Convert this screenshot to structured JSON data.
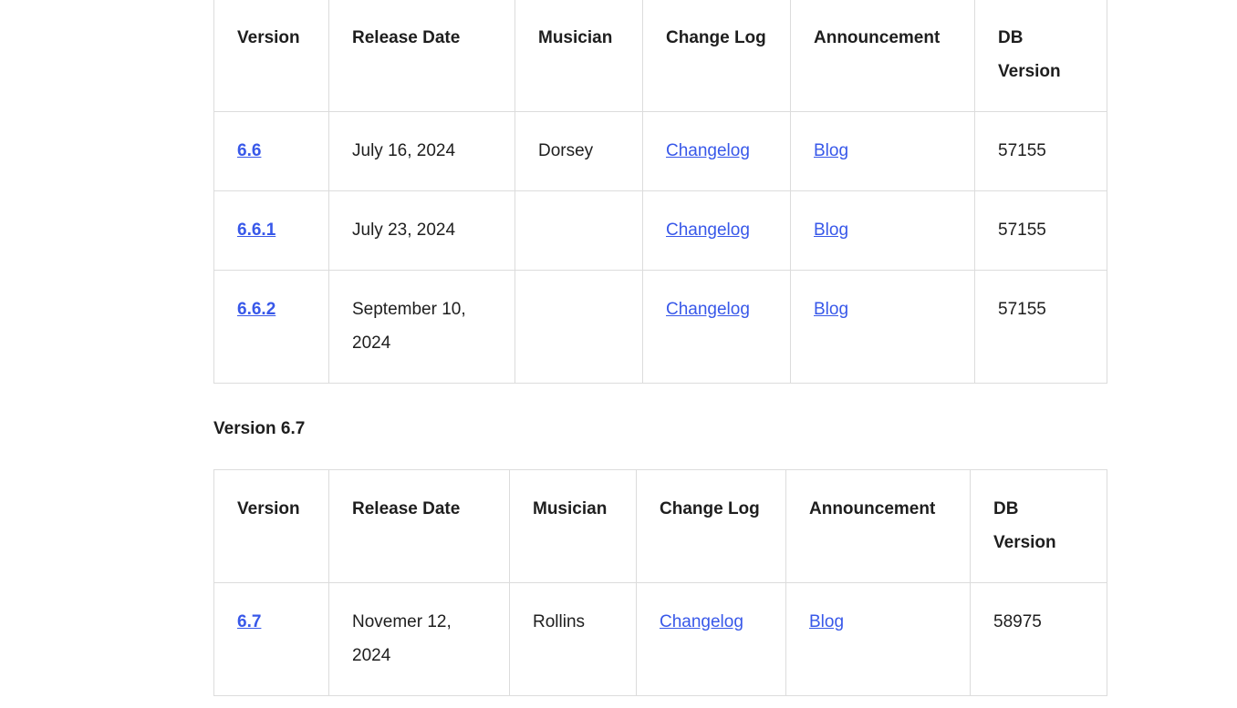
{
  "headers": [
    "Version",
    "Release Date",
    "Musician",
    "Change Log",
    "Announcement",
    "DB Version"
  ],
  "table_66": {
    "rows": [
      {
        "version": "6.6",
        "date": "July 16, 2024",
        "musician": "Dorsey",
        "changelog": "Changelog",
        "announcement": "Blog",
        "db": "57155"
      },
      {
        "version": "6.6.1",
        "date": "July 23, 2024",
        "musician": "",
        "changelog": "Changelog",
        "announcement": "Blog",
        "db": "57155"
      },
      {
        "version": "6.6.2",
        "date": "September 10, 2024",
        "musician": "",
        "changelog": "Changelog",
        "announcement": "Blog",
        "db": "57155"
      }
    ]
  },
  "section_67": {
    "heading": "Version 6.7"
  },
  "table_67": {
    "rows": [
      {
        "version": "6.7",
        "date": "Novemer 12, 2024",
        "musician": "Rollins",
        "changelog": "Changelog",
        "announcement": "Blog",
        "db": "58975"
      }
    ]
  },
  "colors": {
    "link": "#3858e9",
    "border": "#dcdcdc",
    "text": "#1e1e1e"
  }
}
